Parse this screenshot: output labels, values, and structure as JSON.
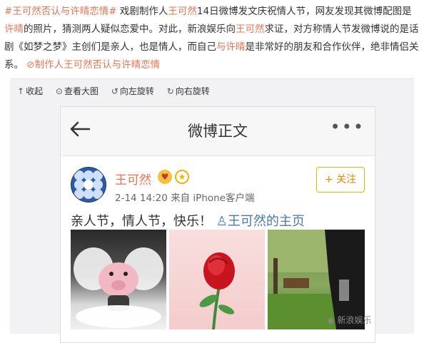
{
  "article": {
    "hashtag": "#王可然否认与许晴恋情#",
    "t1": "戏剧制作人",
    "name1": "王可然",
    "t2": "14日微博发文庆祝情人节，网友发现其微博配图是",
    "name2": "许晴",
    "t3": "的照片，猜测两人疑似恋爱中。对此，新浪娱乐向",
    "name3": "王可然",
    "t4": "求证，对方称情人节发微博说的是话剧《如梦之梦》主创们是亲人，也是情人，而自己",
    "name4": "与许晴",
    "t5": "是非常好的朋友和合作伙伴，绝非情侣关系。",
    "link_icon": "link-icon",
    "link_text": "制作人王可然否认与许晴恋情"
  },
  "toolbar": {
    "collapse": "收起",
    "view_large": "查看大图",
    "rotate_left": "向左旋转",
    "rotate_right": "向右旋转"
  },
  "screenshot": {
    "nav_title": "微博正文",
    "more": "•••",
    "user_name": "王可然",
    "post_time": "2-14 14:20",
    "source": "来自 iPhone客户端",
    "follow": "+ 关注",
    "post_text": "亲人节，情人节，快乐！",
    "mention_link": "王可然的主页"
  },
  "watermark": "新浪娱乐"
}
